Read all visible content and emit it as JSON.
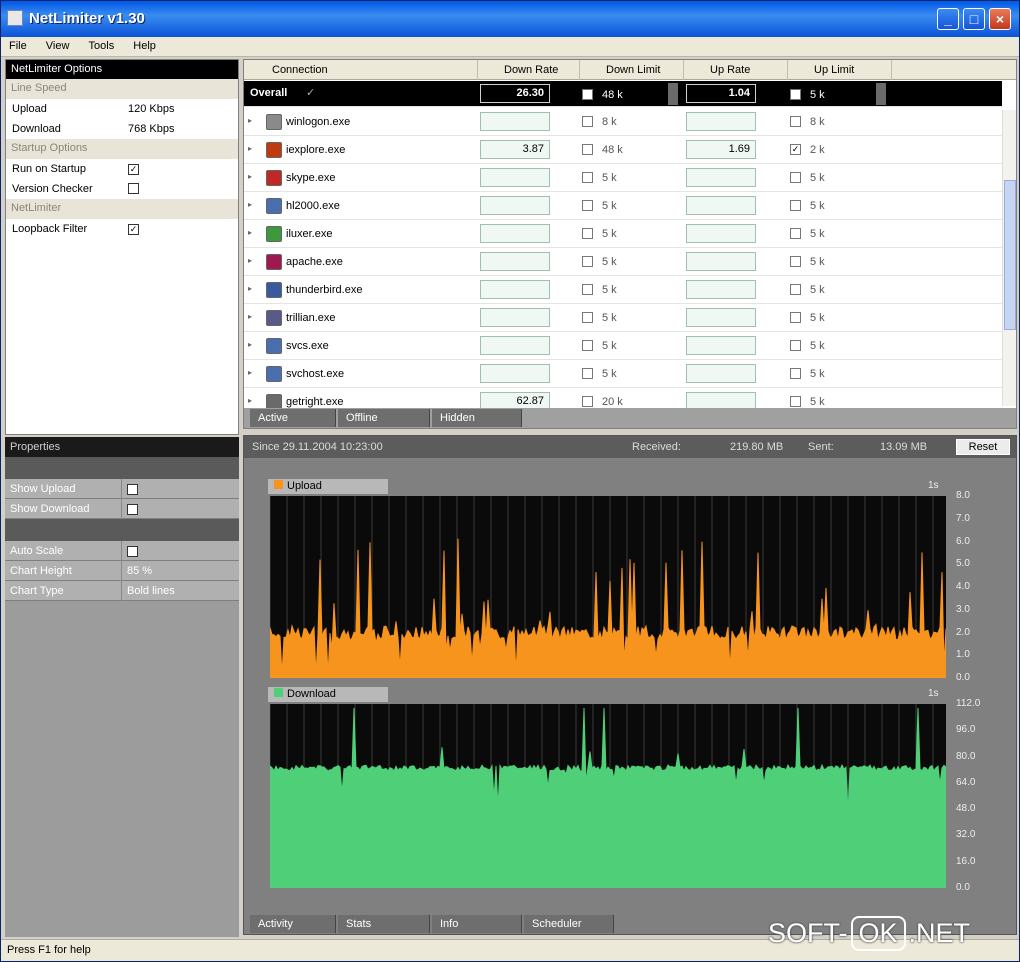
{
  "window": {
    "title": "NetLimiter v1.30"
  },
  "menu": [
    "File",
    "View",
    "Tools",
    "Help"
  ],
  "options_panel": {
    "title": "NetLimiter Options",
    "categories": [
      {
        "name": "Line Speed",
        "rows": [
          {
            "label": "Upload",
            "value": "120 Kbps"
          },
          {
            "label": "Download",
            "value": "768 Kbps"
          }
        ]
      },
      {
        "name": "Startup Options",
        "rows": [
          {
            "label": "Run on Startup",
            "checked": true
          },
          {
            "label": "Version Checker",
            "checked": false
          }
        ]
      },
      {
        "name": "NetLimiter",
        "rows": [
          {
            "label": "Loopback Filter",
            "checked": true
          }
        ]
      }
    ]
  },
  "properties_panel": {
    "title": "Properties",
    "group1": [
      {
        "label": "Show Upload",
        "checked": true
      },
      {
        "label": "Show Download",
        "checked": true
      }
    ],
    "group2": [
      {
        "label": "Auto Scale",
        "checked": true
      },
      {
        "label": "Chart Height",
        "value": "85 %"
      },
      {
        "label": "Chart Type",
        "value": "Bold lines"
      }
    ]
  },
  "grid": {
    "columns": [
      "Connection",
      "Down Rate",
      "Down Limit",
      "Up Rate",
      "Up Limit"
    ],
    "overall": {
      "name": "Overall",
      "down_rate": "26.30",
      "down_limit": "48 k",
      "up_rate": "1.04",
      "up_limit": "5 k"
    },
    "rows": [
      {
        "name": "winlogon.exe",
        "down_rate": "",
        "down_limit": "8 k",
        "up_rate": "",
        "up_limit": "8 k",
        "up_checked": false,
        "color": "#8a8a8a"
      },
      {
        "name": "iexplore.exe",
        "down_rate": "3.87",
        "down_limit": "48 k",
        "up_rate": "1.69",
        "up_limit": "2 k",
        "up_checked": true,
        "color": "#c03a10"
      },
      {
        "name": "skype.exe",
        "down_rate": "",
        "down_limit": "5 k",
        "up_rate": "",
        "up_limit": "5 k",
        "up_checked": false,
        "color": "#c02828"
      },
      {
        "name": "hl2000.exe",
        "down_rate": "",
        "down_limit": "5 k",
        "up_rate": "",
        "up_limit": "5 k",
        "up_checked": false,
        "color": "#4a6fb0"
      },
      {
        "name": "iluxer.exe",
        "down_rate": "",
        "down_limit": "5 k",
        "up_rate": "",
        "up_limit": "5 k",
        "up_checked": false,
        "color": "#3c9a3c"
      },
      {
        "name": "apache.exe",
        "down_rate": "",
        "down_limit": "5 k",
        "up_rate": "",
        "up_limit": "5 k",
        "up_checked": false,
        "color": "#a01850"
      },
      {
        "name": "thunderbird.exe",
        "down_rate": "",
        "down_limit": "5 k",
        "up_rate": "",
        "up_limit": "5 k",
        "up_checked": false,
        "color": "#3a5aa0"
      },
      {
        "name": "trillian.exe",
        "down_rate": "",
        "down_limit": "5 k",
        "up_rate": "",
        "up_limit": "5 k",
        "up_checked": false,
        "color": "#5a5a8a"
      },
      {
        "name": "svcs.exe",
        "down_rate": "",
        "down_limit": "5 k",
        "up_rate": "",
        "up_limit": "5 k",
        "up_checked": false,
        "color": "#4a6fb0"
      },
      {
        "name": "svchost.exe",
        "down_rate": "",
        "down_limit": "5 k",
        "up_rate": "",
        "up_limit": "5 k",
        "up_checked": false,
        "color": "#4a6fb0"
      },
      {
        "name": "getright.exe",
        "down_rate": "62.87",
        "down_limit": "20 k",
        "up_rate": "",
        "up_limit": "5 k",
        "up_checked": false,
        "color": "#6a6a6a"
      }
    ],
    "tabs": [
      "Active",
      "Offline",
      "Hidden"
    ]
  },
  "charts": {
    "since": "Since 29.11.2004 10:23:00",
    "received_label": "Received:",
    "received_value": "219.80 MB",
    "sent_label": "Sent:",
    "sent_value": "13.09 MB",
    "reset_label": "Reset",
    "upload": {
      "title": "Upload",
      "color": "#f7941d",
      "ticks": [
        "8.0",
        "7.0",
        "6.0",
        "5.0",
        "4.0",
        "3.0",
        "2.0",
        "1.0",
        "0.0"
      ]
    },
    "download": {
      "title": "Download",
      "color": "#4ecf78",
      "ticks": [
        "112.0",
        "96.0",
        "80.0",
        "64.0",
        "48.0",
        "32.0",
        "16.0",
        "0.0"
      ]
    },
    "tabs": [
      "Activity",
      "Stats",
      "Info",
      "Scheduler"
    ]
  },
  "status": {
    "text": "Press F1 for help"
  },
  "watermark": {
    "left": "SOFT-",
    "ok": "OK",
    "right": ".NET"
  }
}
